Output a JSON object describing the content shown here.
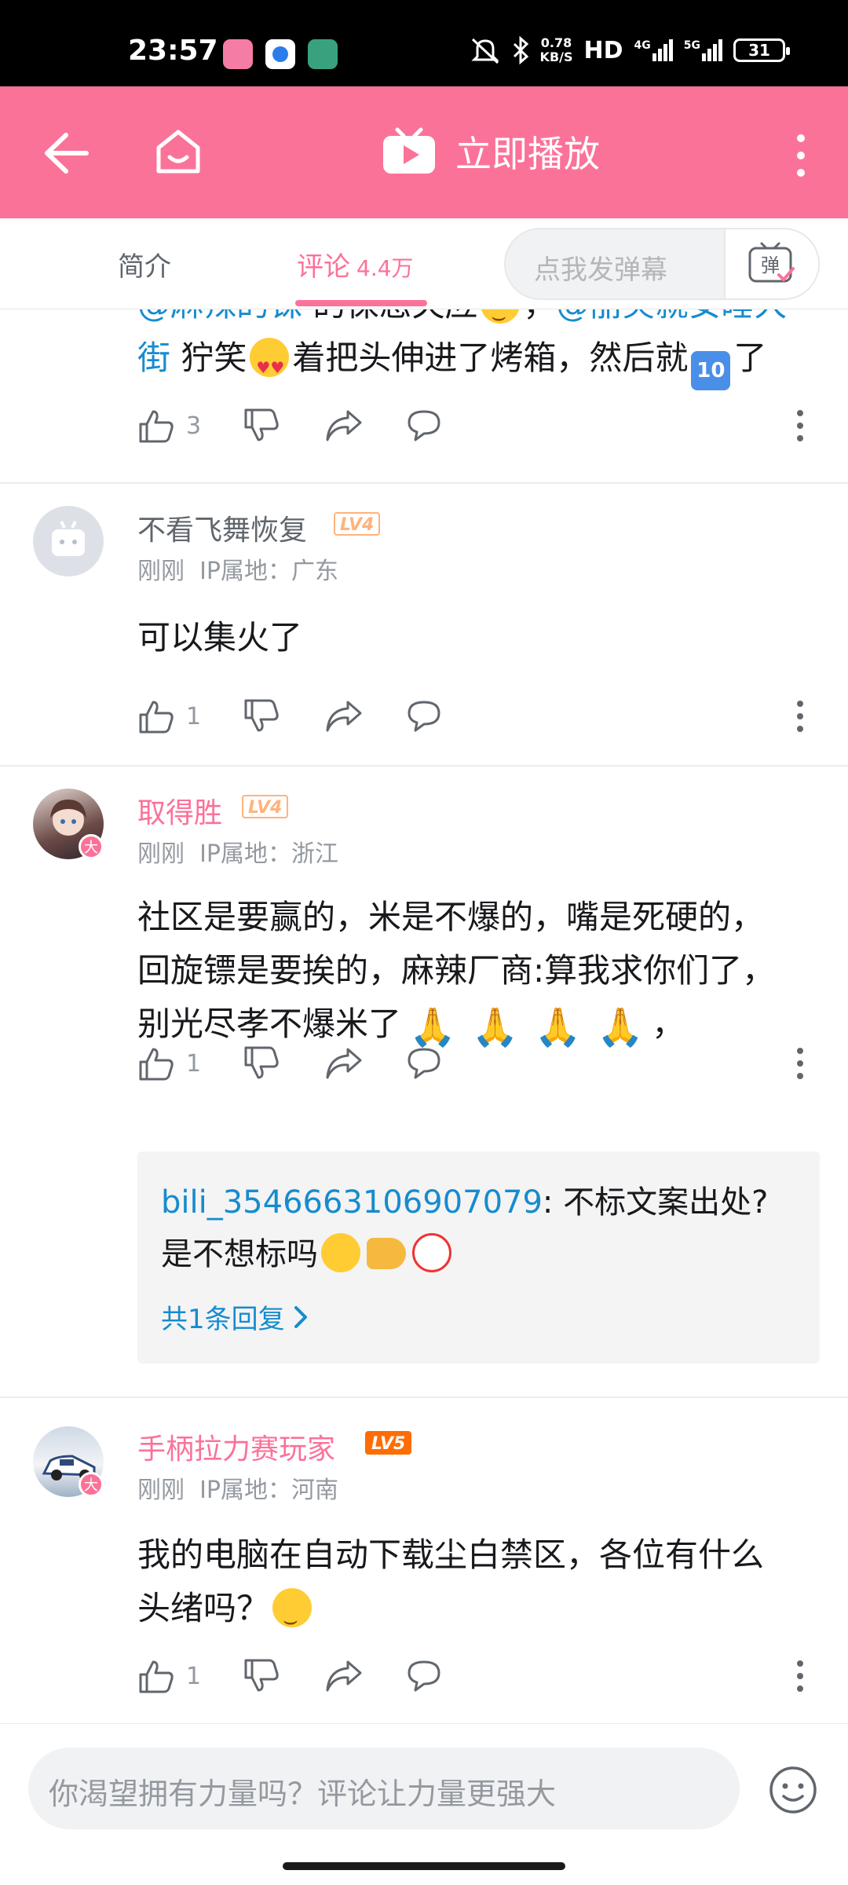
{
  "status_bar": {
    "time": "23:57",
    "speed_value": "0.78",
    "speed_unit": "KB/S",
    "hd": "HD",
    "net1": "4G",
    "net2": "5G",
    "battery": "31"
  },
  "header": {
    "play_label": "立即播放",
    "accent_color": "#fb7299"
  },
  "tabs": {
    "intro": "简介",
    "comments": "评论",
    "comments_count": "4.4万",
    "danmaku_placeholder": "点我发弹幕",
    "danmaku_button": "弹"
  },
  "comments": [
    {
      "partial_line1_mention1": "@麻辣的铢",
      "partial_line1_text": "的保态失应",
      "partial_line1_mention2": "@丽笑就安睡大",
      "line2_mention": "街",
      "line2_a": " 狞笑",
      "line2_b": "着把头伸进了烤箱，然后就",
      "line2_ten": "10",
      "line2_c": "了",
      "likes": "3"
    },
    {
      "username": "不看飞舞恢复",
      "level": "LV4",
      "time": "刚刚",
      "ip_label": "IP属地：",
      "ip": "广东",
      "text": "可以集火了",
      "likes": "1"
    },
    {
      "username": "取得胜",
      "level": "LV4",
      "badge": "大",
      "time": "刚刚",
      "ip_label": "IP属地：",
      "ip": "浙江",
      "text_line1": "社区是要赢的，米是不爆的，嘴是死硬的，",
      "text_line2": "回旋镖是要挨的，麻辣厂商:算我求你们了，",
      "text_line3": "别光尽孝不爆米了",
      "text_tail": "，",
      "likes": "1",
      "reply": {
        "user": "bili_3546663106907079",
        "text_a": ": 不标文案出处?",
        "text_b": "是不想标吗",
        "more": "共1条回复"
      }
    },
    {
      "username": "手柄拉力赛玩家",
      "level": "LV5",
      "badge": "大",
      "time": "刚刚",
      "ip_label": "IP属地：",
      "ip": "河南",
      "text_line1": "我的电脑在自动下载尘白禁区，各位有什么",
      "text_line2": "头绪吗？",
      "likes": "1"
    }
  ],
  "bottom_bar": {
    "input_placeholder": "你渴望拥有力量吗？评论让力量更强大"
  }
}
